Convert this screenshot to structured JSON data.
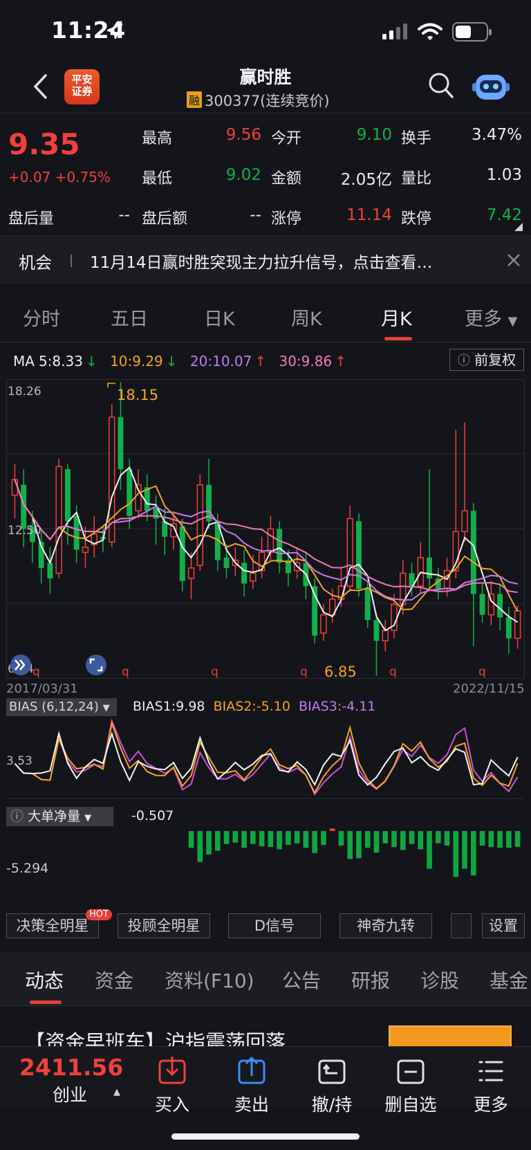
{
  "status_bar": {
    "time": "11:24"
  },
  "nav": {
    "title": "赢时胜",
    "margin_tag": "融",
    "code_status": "300377(连续竞价)",
    "logo_text": "平安证券"
  },
  "quote": {
    "price": "9.35",
    "change": "+0.07 +0.75%",
    "fields": [
      {
        "label": "最高",
        "value": "9.56",
        "color": "#f0413c"
      },
      {
        "label": "今开",
        "value": "9.10",
        "color": "#12b04a"
      },
      {
        "label": "换手",
        "value": "3.47%",
        "color": "#ececf0"
      },
      {
        "label": "最低",
        "value": "9.02",
        "color": "#12b04a"
      },
      {
        "label": "金额",
        "value": "2.05亿",
        "color": "#ececf0"
      },
      {
        "label": "量比",
        "value": "1.03",
        "color": "#ececf0"
      },
      {
        "label": "盘后额",
        "value": "--",
        "color": "#ececf0"
      },
      {
        "label": "涨停",
        "value": "11.14",
        "color": "#f0413c"
      },
      {
        "label": "跌停",
        "value": "7.42",
        "color": "#12b04a"
      }
    ],
    "after_vol_label": "盘后量",
    "after_vol_value": "--"
  },
  "news": {
    "tag": "机会",
    "text": "11月14日赢时胜突现主力拉升信号，点击查看…"
  },
  "chart_tabs": [
    "分时",
    "五日",
    "日K",
    "周K",
    "月K",
    "更多"
  ],
  "ma": {
    "label": "MA",
    "ma5": "5:8.33",
    "ma10": "10:9.29",
    "ma20": "20:10.07",
    "ma30": "30:9.86"
  },
  "fuquan": "前复权",
  "chart_labels": {
    "y_top": "18.26",
    "y_mid": "12.50",
    "y_low": "6.74",
    "high_mark": "18.15",
    "low_mark": "6.85",
    "date_start": "2017/03/31",
    "date_end": "2022/11/15"
  },
  "bias": {
    "selector": "BIAS (6,12,24)",
    "bias1": "BIAS1:9.98",
    "bias2": "BIAS2:-5.10",
    "bias3": "BIAS3:-4.11",
    "axis": "3.53"
  },
  "flow": {
    "selector": "大单净量",
    "value": "-0.507",
    "axis": "-5.294"
  },
  "tool_buttons": [
    "决策全明星",
    "投顾全明星",
    "D信号",
    "神奇九转",
    "设置"
  ],
  "hot": "HOT",
  "bottom_tabs": [
    "动态",
    "资金",
    "资料(F10)",
    "公告",
    "研报",
    "诊股",
    "基金"
  ],
  "news_headline": "【资金早班车】沪指震荡回落",
  "toolbar": {
    "index_value": "2411.56",
    "index_name": "创业",
    "items": [
      "买入",
      "卖出",
      "撤/持",
      "删自选",
      "更多"
    ]
  },
  "colors": {
    "up": "#f0413c",
    "down": "#12b04a",
    "bg": "#14151a"
  },
  "chart_data": {
    "type": "candlestick",
    "candles": [
      {
        "o": 13.8,
        "c": 14.4,
        "h": 15.0,
        "l": 12.9
      },
      {
        "o": 14.2,
        "c": 12.5,
        "h": 14.8,
        "l": 11.8
      },
      {
        "o": 12.6,
        "c": 12.0,
        "h": 13.2,
        "l": 11.2
      },
      {
        "o": 12.0,
        "c": 11.0,
        "h": 12.4,
        "l": 10.4
      },
      {
        "o": 11.2,
        "c": 10.6,
        "h": 11.8,
        "l": 10.0
      },
      {
        "o": 10.8,
        "c": 14.9,
        "h": 15.2,
        "l": 10.6
      },
      {
        "o": 14.8,
        "c": 12.8,
        "h": 15.0,
        "l": 11.9
      },
      {
        "o": 13.0,
        "c": 11.7,
        "h": 13.4,
        "l": 11.2
      },
      {
        "o": 11.6,
        "c": 11.8,
        "h": 12.6,
        "l": 11.0
      },
      {
        "o": 11.9,
        "c": 12.3,
        "h": 13.0,
        "l": 11.4
      },
      {
        "o": 12.2,
        "c": 12.1,
        "h": 12.6,
        "l": 11.6
      },
      {
        "o": 12.0,
        "c": 16.8,
        "h": 17.3,
        "l": 11.8
      },
      {
        "o": 16.8,
        "c": 14.8,
        "h": 18.15,
        "l": 14.0
      },
      {
        "o": 14.8,
        "c": 13.0,
        "h": 15.2,
        "l": 12.5
      },
      {
        "o": 13.2,
        "c": 14.2,
        "h": 14.8,
        "l": 12.9
      },
      {
        "o": 14.1,
        "c": 13.2,
        "h": 14.6,
        "l": 12.8
      },
      {
        "o": 13.3,
        "c": 12.9,
        "h": 13.8,
        "l": 11.9
      },
      {
        "o": 12.8,
        "c": 12.2,
        "h": 13.3,
        "l": 11.5
      },
      {
        "o": 12.2,
        "c": 12.7,
        "h": 13.1,
        "l": 11.7
      },
      {
        "o": 12.6,
        "c": 10.5,
        "h": 12.9,
        "l": 10.1
      },
      {
        "o": 10.6,
        "c": 11.0,
        "h": 11.6,
        "l": 9.8
      },
      {
        "o": 11.1,
        "c": 14.2,
        "h": 14.6,
        "l": 10.9
      },
      {
        "o": 14.2,
        "c": 12.8,
        "h": 15.2,
        "l": 12.5
      },
      {
        "o": 12.8,
        "c": 11.3,
        "h": 13.1,
        "l": 10.9
      },
      {
        "o": 11.4,
        "c": 11.0,
        "h": 11.9,
        "l": 10.6
      },
      {
        "o": 11.1,
        "c": 11.3,
        "h": 11.8,
        "l": 10.7
      },
      {
        "o": 11.2,
        "c": 10.4,
        "h": 11.7,
        "l": 9.9
      },
      {
        "o": 10.5,
        "c": 10.8,
        "h": 11.5,
        "l": 10.2
      },
      {
        "o": 10.9,
        "c": 11.6,
        "h": 12.2,
        "l": 10.6
      },
      {
        "o": 11.6,
        "c": 12.5,
        "h": 13.0,
        "l": 11.3
      },
      {
        "o": 12.5,
        "c": 11.2,
        "h": 12.8,
        "l": 10.8
      },
      {
        "o": 11.3,
        "c": 10.8,
        "h": 11.7,
        "l": 10.3
      },
      {
        "o": 10.9,
        "c": 11.2,
        "h": 11.8,
        "l": 10.6
      },
      {
        "o": 11.2,
        "c": 10.3,
        "h": 11.6,
        "l": 9.8
      },
      {
        "o": 10.3,
        "c": 8.4,
        "h": 10.6,
        "l": 8.1
      },
      {
        "o": 8.5,
        "c": 9.2,
        "h": 9.6,
        "l": 8.2
      },
      {
        "o": 9.2,
        "c": 9.8,
        "h": 10.2,
        "l": 8.9
      },
      {
        "o": 9.8,
        "c": 10.3,
        "h": 11.0,
        "l": 9.5
      },
      {
        "o": 10.3,
        "c": 12.9,
        "h": 13.4,
        "l": 10.1
      },
      {
        "o": 12.8,
        "c": 10.2,
        "h": 13.1,
        "l": 9.9
      },
      {
        "o": 10.2,
        "c": 9.0,
        "h": 10.5,
        "l": 8.7
      },
      {
        "o": 9.0,
        "c": 8.2,
        "h": 9.3,
        "l": 6.85
      },
      {
        "o": 8.2,
        "c": 8.6,
        "h": 9.0,
        "l": 7.8
      },
      {
        "o": 8.6,
        "c": 9.6,
        "h": 10.0,
        "l": 8.3
      },
      {
        "o": 9.6,
        "c": 10.8,
        "h": 11.3,
        "l": 9.2
      },
      {
        "o": 10.8,
        "c": 10.3,
        "h": 11.2,
        "l": 9.9
      },
      {
        "o": 10.3,
        "c": 11.4,
        "h": 12.0,
        "l": 10.0
      },
      {
        "o": 11.4,
        "c": 10.6,
        "h": 14.8,
        "l": 10.2
      },
      {
        "o": 10.6,
        "c": 10.2,
        "h": 11.0,
        "l": 9.8
      },
      {
        "o": 10.2,
        "c": 10.9,
        "h": 11.4,
        "l": 9.9
      },
      {
        "o": 10.9,
        "c": 12.4,
        "h": 16.3,
        "l": 10.6
      },
      {
        "o": 12.4,
        "c": 13.2,
        "h": 16.6,
        "l": 12.0
      },
      {
        "o": 13.2,
        "c": 10.0,
        "h": 13.5,
        "l": 8.0
      },
      {
        "o": 10.0,
        "c": 9.2,
        "h": 10.4,
        "l": 8.9
      },
      {
        "o": 9.2,
        "c": 10.0,
        "h": 10.5,
        "l": 8.8
      },
      {
        "o": 10.0,
        "c": 9.1,
        "h": 10.4,
        "l": 8.6
      },
      {
        "o": 9.1,
        "c": 8.3,
        "h": 9.5,
        "l": 7.7
      },
      {
        "o": 8.3,
        "c": 9.35,
        "h": 9.56,
        "l": 7.9
      }
    ]
  }
}
